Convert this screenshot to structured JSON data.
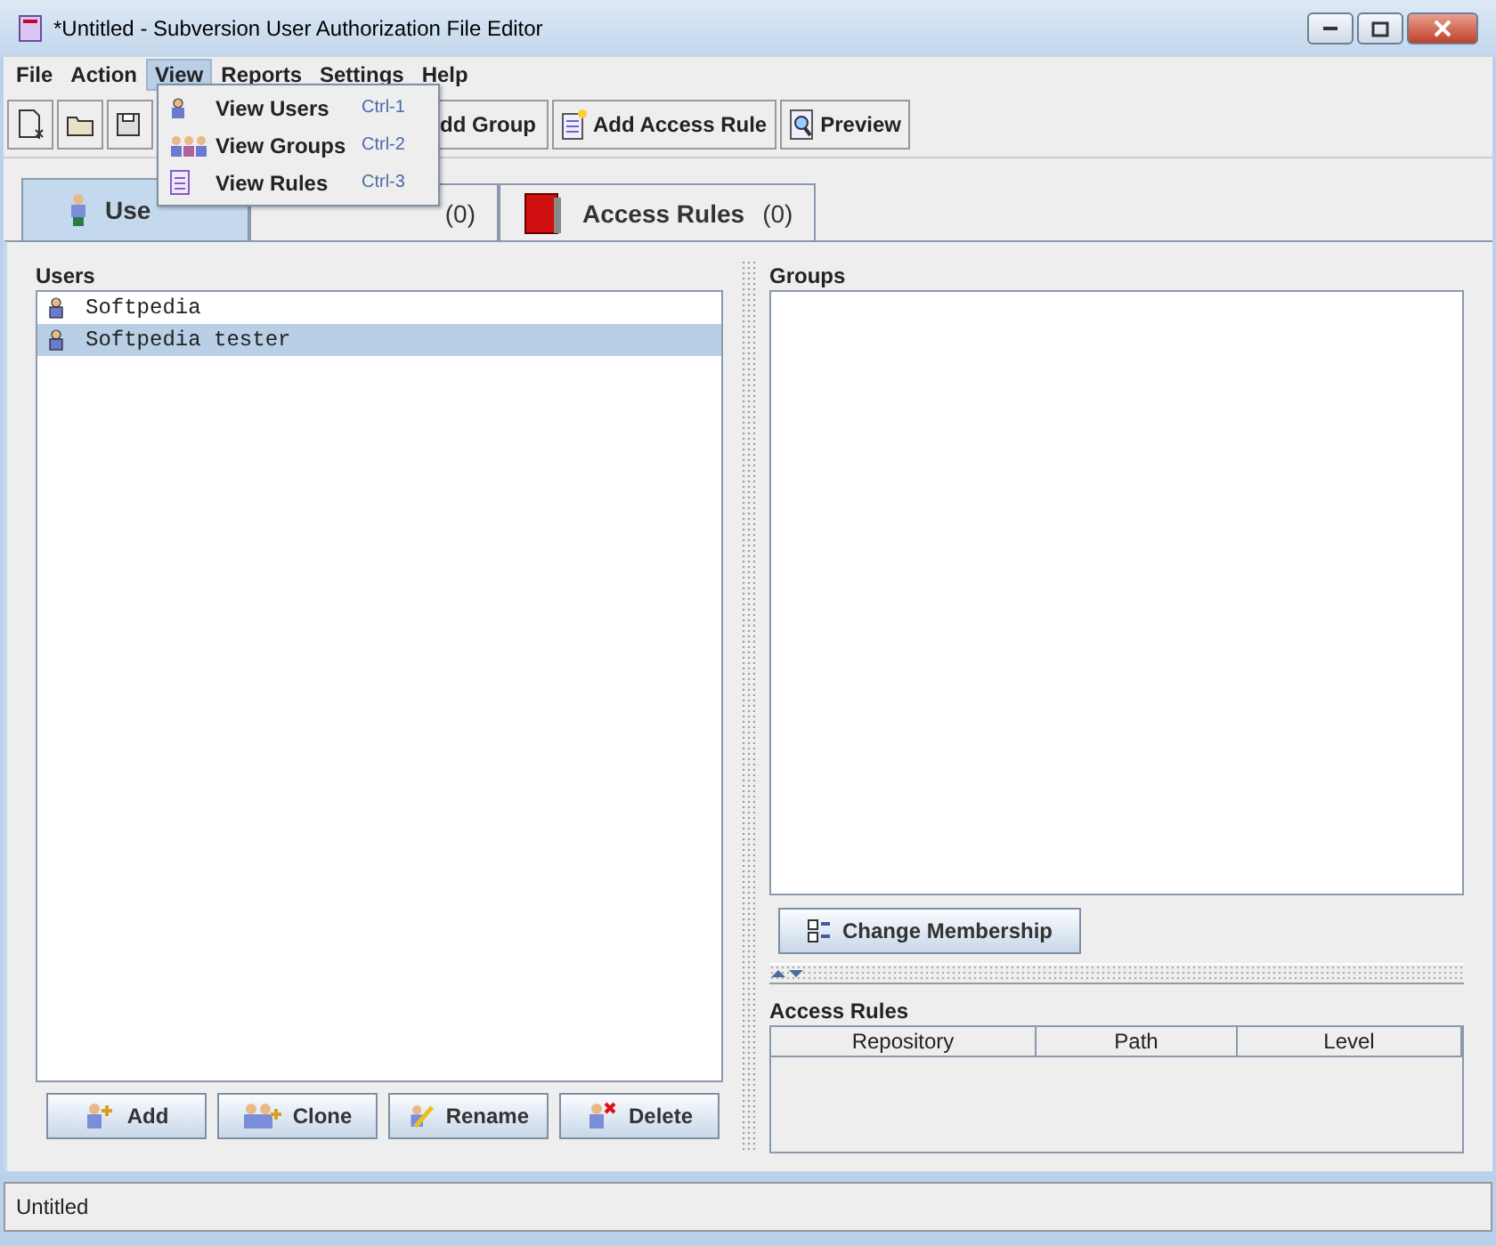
{
  "window": {
    "title": "*Untitled - Subversion User Authorization File Editor"
  },
  "menu_bar": [
    {
      "label": "File",
      "selected": false
    },
    {
      "label": "Action",
      "selected": false
    },
    {
      "label": "View",
      "selected": true
    },
    {
      "label": "Reports",
      "selected": false
    },
    {
      "label": "Settings",
      "selected": false
    },
    {
      "label": "Help",
      "selected": false
    }
  ],
  "view_menu": [
    {
      "kind": "user",
      "label": "View Users",
      "shortcut": "Ctrl-1"
    },
    {
      "kind": "group",
      "label": "View Groups",
      "shortcut": "Ctrl-2"
    },
    {
      "kind": "rules",
      "label": "View Rules",
      "shortcut": "Ctrl-3"
    }
  ],
  "toolbar": [
    {
      "kind": "new"
    },
    {
      "kind": "open"
    },
    {
      "kind": "save"
    },
    {
      "kind": "group",
      "label": "dd Group"
    },
    {
      "kind": "rule",
      "label": "Add Access Rule"
    },
    {
      "kind": "preview",
      "label": "Preview"
    }
  ],
  "tabs": [
    {
      "kind": "user",
      "label": "Use",
      "selected": true
    },
    {
      "kind": "hidden",
      "count": "(0)",
      "selected": false
    },
    {
      "kind": "book",
      "label": "Access Rules",
      "count": "(0)",
      "selected": false
    }
  ],
  "users": {
    "title": "Users",
    "items": [
      {
        "name": "Softpedia",
        "selected": false
      },
      {
        "name": "Softpedia tester",
        "selected": true
      }
    ],
    "buttons": [
      {
        "kind": "add",
        "label": "Add"
      },
      {
        "kind": "clone",
        "label": "Clone"
      },
      {
        "kind": "rename",
        "label": "Rename"
      },
      {
        "kind": "delete",
        "label": "Delete"
      }
    ]
  },
  "groups": {
    "title": "Groups",
    "button": "Change Membership"
  },
  "access_rules": {
    "title": "Access Rules",
    "columns": [
      "Repository",
      "Path",
      "Level"
    ]
  },
  "status_bar": "Untitled"
}
